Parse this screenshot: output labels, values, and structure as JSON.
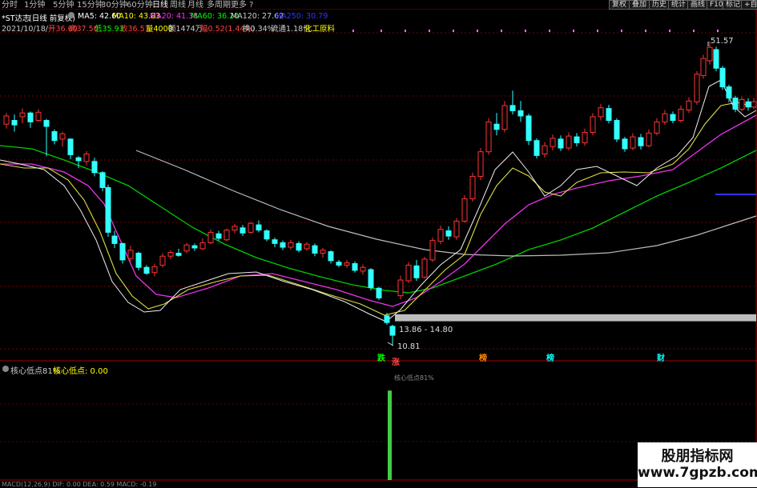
{
  "toolbar": {
    "tabs": [
      "分时",
      "1分钟",
      "5分钟",
      "15分钟",
      "30分钟",
      "60分钟",
      "日线",
      "周线",
      "月线",
      "多周期",
      "更多 ?"
    ],
    "right_buttons": [
      "复权",
      "叠加",
      "历史",
      "统计",
      "画线",
      "F10",
      "标记",
      "+自"
    ]
  },
  "header": {
    "stock_name": "*ST达志",
    "period_label": "(日线 前复权)",
    "ma": [
      {
        "label": "MA5: 42.60",
        "color": "#ffffff"
      },
      {
        "label": "MA10: 43.83",
        "color": "#ffff00"
      },
      {
        "label": "MA20: 41.38",
        "color": "#ff33ff"
      },
      {
        "label": "MA60: 36.20",
        "color": "#00ff00"
      },
      {
        "label": "MA120: 27.62",
        "color": "#cccccc"
      },
      {
        "label": "MA250: 30.79",
        "color": "#3333ff"
      }
    ],
    "date": "2021/10/18/一",
    "quote": [
      {
        "label": "开36.60",
        "color": "#ff4444"
      },
      {
        "label": "高37.50",
        "color": "#ff4444"
      },
      {
        "label": "低35.93",
        "color": "#00ff00"
      },
      {
        "label": "收36.57",
        "color": "#ff4444"
      },
      {
        "label": "量4000",
        "color": "#ffff00"
      },
      {
        "label": "额1474万",
        "color": "#cccccc"
      },
      {
        "label": "幅0.52(1.44%)",
        "color": "#ff4444"
      },
      {
        "label": "换0.34%",
        "color": "#cccccc"
      },
      {
        "label": "流通1.18亿",
        "color": "#cccccc"
      },
      {
        "label": "化工原料",
        "color": "#ffff00"
      }
    ]
  },
  "main_chart": {
    "high_label": "51.57",
    "low_label": "10.81",
    "zone_label": "13.86 - 14.80",
    "event_tags": [
      {
        "text": "跌",
        "color": "#00ff00"
      },
      {
        "text": "涨",
        "color": "#ff4444"
      },
      {
        "text": "榜",
        "color": "#ff8800"
      },
      {
        "text": "榜",
        "color": "#00ffff"
      },
      {
        "text": "财",
        "color": "#00ffff"
      }
    ]
  },
  "indicator": {
    "title": "核心低点81%",
    "value_label": "核心低点: 0.00",
    "signal_label": "核心低点81%"
  },
  "footer": {
    "macd_label": "MACD(12,26,9) DIF: 0.00 DEA: 0.59 MACD: -0.19"
  },
  "watermark": {
    "line1": "股朋指标网",
    "line2": "www.7gpzb.com"
  },
  "chart_data": {
    "type": "candlestick",
    "y_marked": {
      "high": 51.57,
      "low": 10.81
    },
    "zone": [
      13.86,
      14.8
    ],
    "ma_current": {
      "MA5": 42.6,
      "MA10": 43.83,
      "MA20": 41.38,
      "MA60": 36.2,
      "MA120": 27.62,
      "MA250": 30.79
    },
    "indicator_value": 0.0,
    "signal_level": 81
  }
}
